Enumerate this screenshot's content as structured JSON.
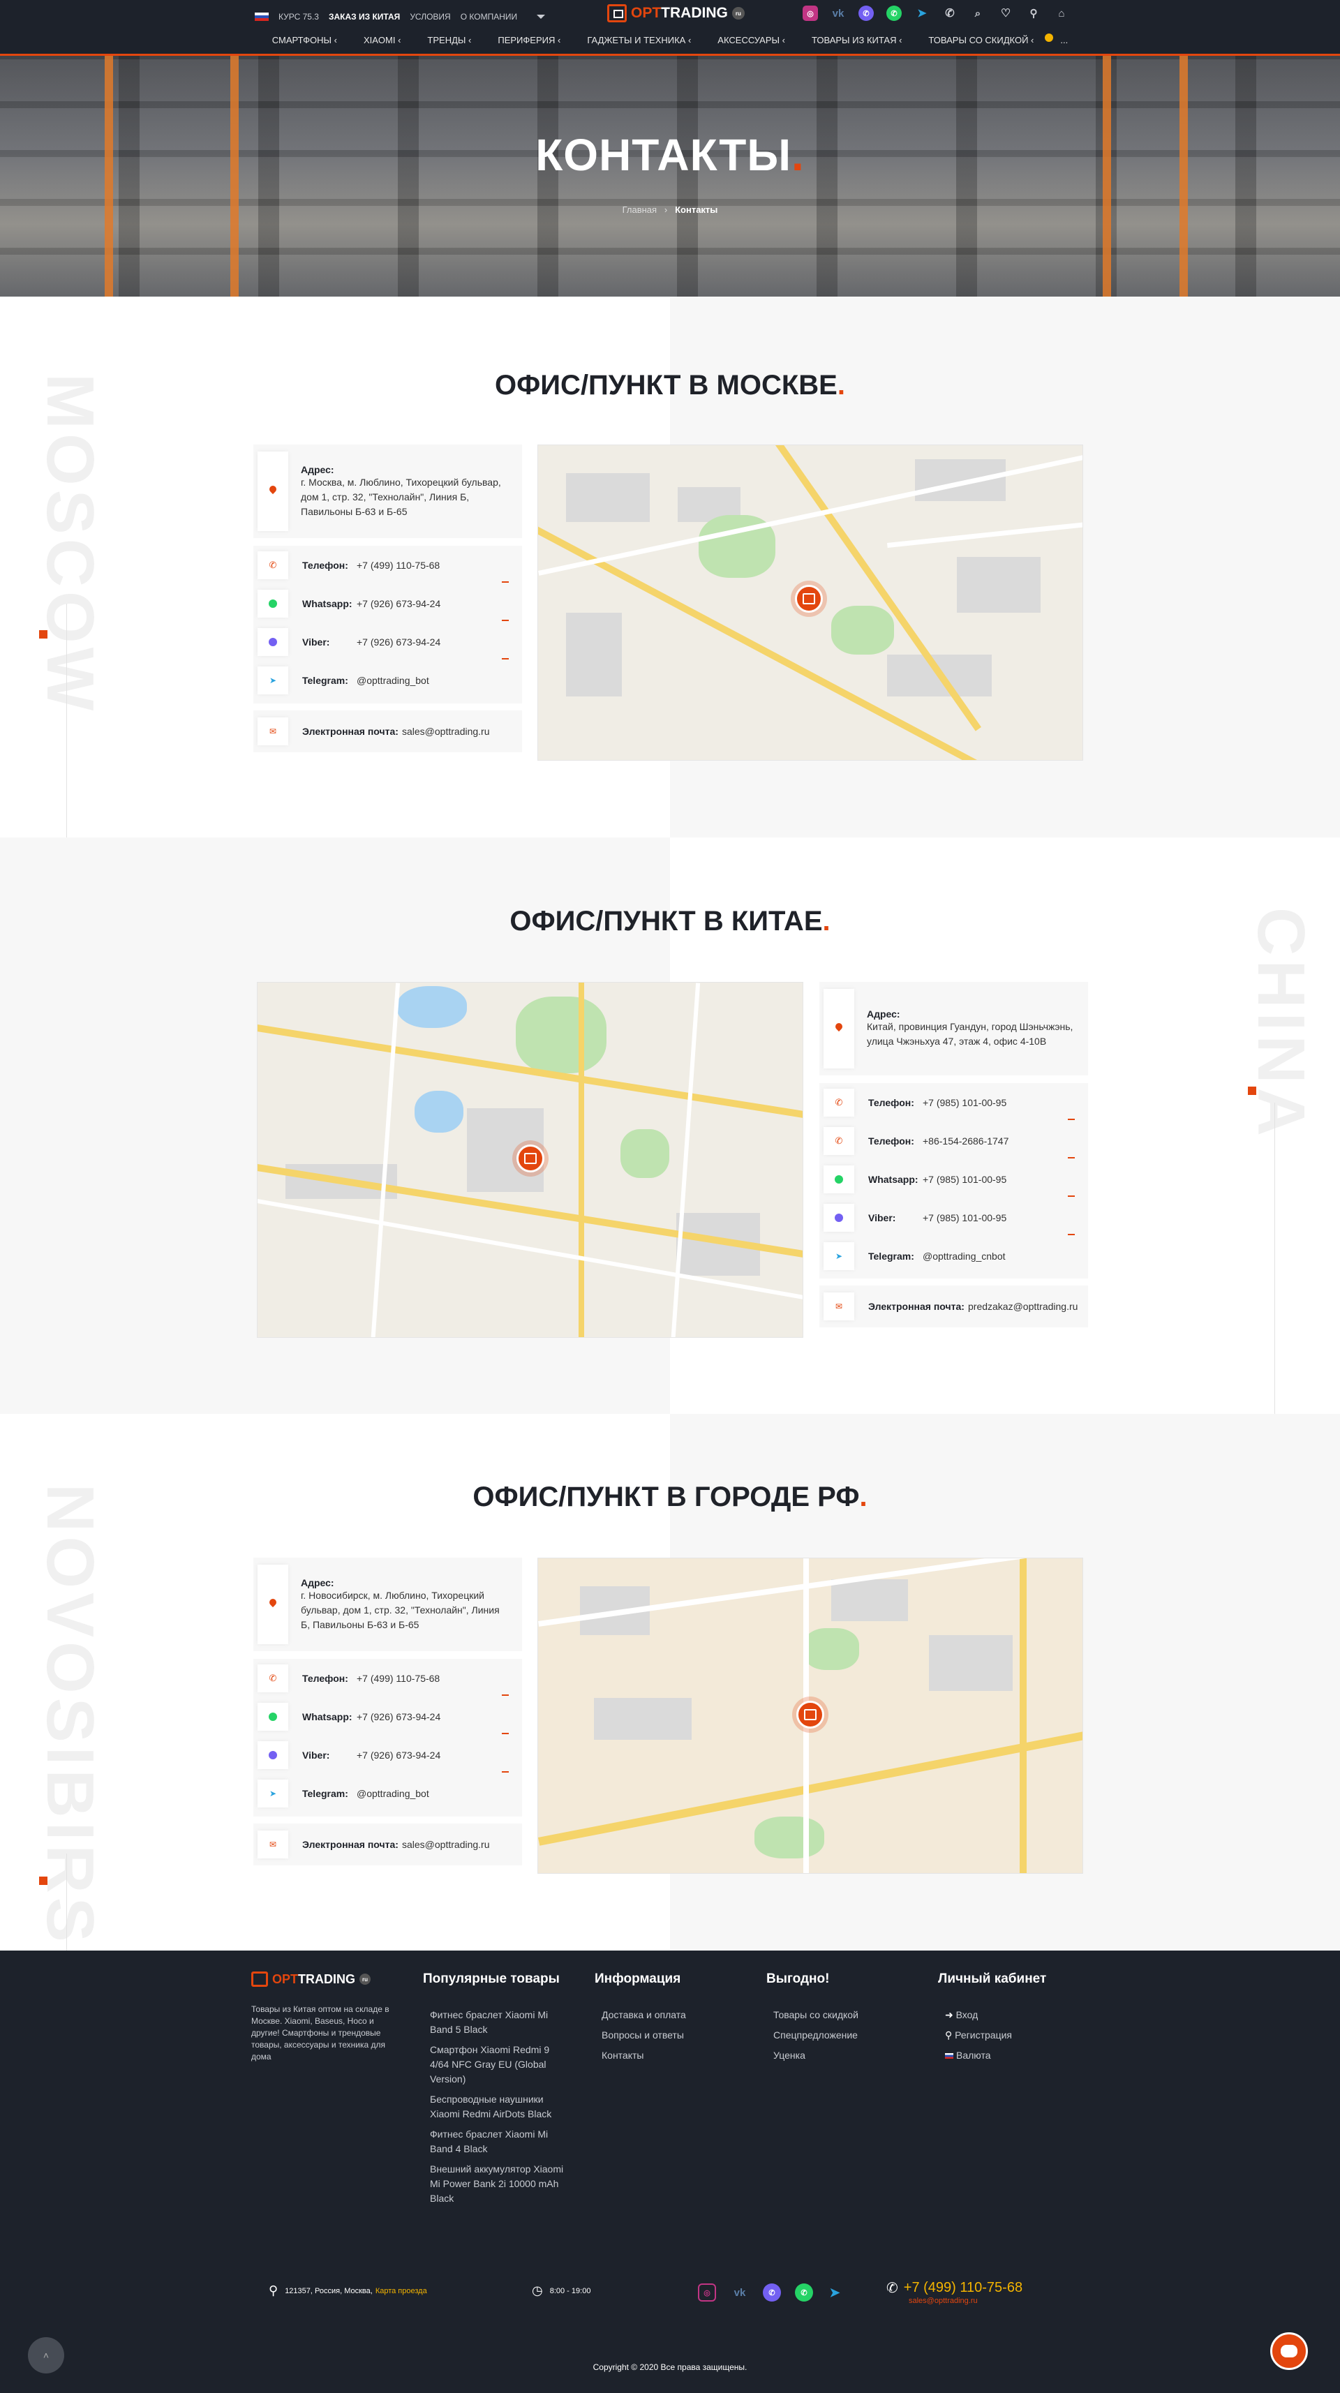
{
  "topbar": {
    "rate_label": "КУРС 75.3",
    "nav": [
      "ЗАКАЗ ИЗ КИТАЯ",
      "УСЛОВИЯ",
      "О КОМПАНИИ"
    ],
    "logo_opt": "OPT",
    "logo_trading": "TRADING",
    "logo_ru": "ru",
    "cart_count": ""
  },
  "menu": [
    "СМАРТФОНЫ",
    "XIAOMI",
    "ТРЕНДЫ",
    "ПЕРИФЕРИЯ",
    "ГАДЖЕТЫ И ТЕХНИКА",
    "АКСЕССУАРЫ",
    "ТОВАРЫ ИЗ КИТАЯ",
    "ТОВАРЫ СО СКИДКОЙ",
    "..."
  ],
  "hero": {
    "title": "КОНТАКТЫ",
    "title_dot": ".",
    "crumb_home": "Главная",
    "crumb_sep": "›",
    "crumb_current": "Контакты"
  },
  "moscow": {
    "side_word": "MOSCOW",
    "title": "ОФИС/ПУНКТ В МОСКВЕ",
    "dot": ".",
    "address_label": "Адрес:",
    "address": "г. Москва, м. Люблино, Тихорецкий бульвар, дом 1, стр. 32, \"Технолайн\", Линия Б, Павильоны Б-63 и Б-65",
    "rows": [
      {
        "label": "Телефон:",
        "value": "+7 (499) 110-75-68"
      },
      {
        "label": "Whatsapp:",
        "value": "+7 (926) 673-94-24"
      },
      {
        "label": "Viber:",
        "value": "+7 (926) 673-94-24"
      },
      {
        "label": "Telegram:",
        "value": "@opttrading_bot"
      }
    ],
    "email_label": "Электронная почта:",
    "email": "sales@opttrading.ru"
  },
  "china": {
    "side_word": "CHINA",
    "title": "ОФИС/ПУНКТ В КИТАЕ",
    "dot": ".",
    "address_label": "Адрес:",
    "address": "Китай, провинция Гуандун, город Шэньчжэнь, улица Чжэньхуа 47, этаж 4, офис 4-10В",
    "rows": [
      {
        "label": "Телефон:",
        "value": "+7 (985) 101-00-95"
      },
      {
        "label": "Телефон:",
        "value": "+86-154-2686-1747"
      },
      {
        "label": "Whatsapp:",
        "value": "+7 (985) 101-00-95"
      },
      {
        "label": "Viber:",
        "value": "+7 (985) 101-00-95"
      },
      {
        "label": "Telegram:",
        "value": "@opttrading_cnbot"
      }
    ],
    "email_label": "Электронная почта:",
    "email": "predzakaz@opttrading.ru"
  },
  "city": {
    "side_word": "NOVOSIBIRSK",
    "title": "ОФИС/ПУНКТ В ГОРОДЕ РФ",
    "dot": ".",
    "address_label": "Адрес:",
    "address": "г. Новосибирск, м. Люблино, Тихорецкий бульвар, дом 1, стр. 32, \"Технолайн\", Линия Б, Павильоны Б-63 и Б-65",
    "rows": [
      {
        "label": "Телефон:",
        "value": "+7 (499) 110-75-68"
      },
      {
        "label": "Whatsapp:",
        "value": "+7 (926) 673-94-24"
      },
      {
        "label": "Viber:",
        "value": "+7 (926) 673-94-24"
      },
      {
        "label": "Telegram:",
        "value": "@opttrading_bot"
      }
    ],
    "email_label": "Электронная почта:",
    "email": "sales@opttrading.ru"
  },
  "footer": {
    "desc": "Товары из Китая оптом на складе в Москве. Xiaomi, Baseus, Hoco и другие! Смартфоны и трендовые товары, аксессуары и техника для дома",
    "col_popular": "Популярные товары",
    "popular": [
      "Фитнес браслет Xiaomi Mi Band 5 Black",
      "Смартфон Xiaomi Redmi 9 4/64 NFC Gray EU (Global Version)",
      "Беспроводные наушники Xiaomi Redmi AirDots Black",
      "Фитнес браслет Xiaomi Mi Band 4 Black",
      "Внешний аккумулятор Xiaomi Mi Power Bank 2i 10000 mAh Black"
    ],
    "col_info": "Информация",
    "info": [
      "Доставка и оплата",
      "Вопросы и ответы",
      "Контакты"
    ],
    "col_profit": "Выгодно!",
    "profit": [
      "Товары со скидкой",
      "Спецпредложение",
      "Уценка"
    ],
    "col_account": "Личный кабинет",
    "account": [
      "Вход",
      "Регистрация",
      "Валюта"
    ],
    "address": "121357, Россия, Москва,",
    "map_link": "Карта проезда",
    "hours": "8:00 - 19:00",
    "phone": "+7 (499) 110-75-68",
    "email": "sales@opttrading.ru",
    "copyright": "Copyright © 2020 Все права защищены."
  },
  "colors": {
    "accent": "#e3460e",
    "dark": "#1d222b"
  }
}
